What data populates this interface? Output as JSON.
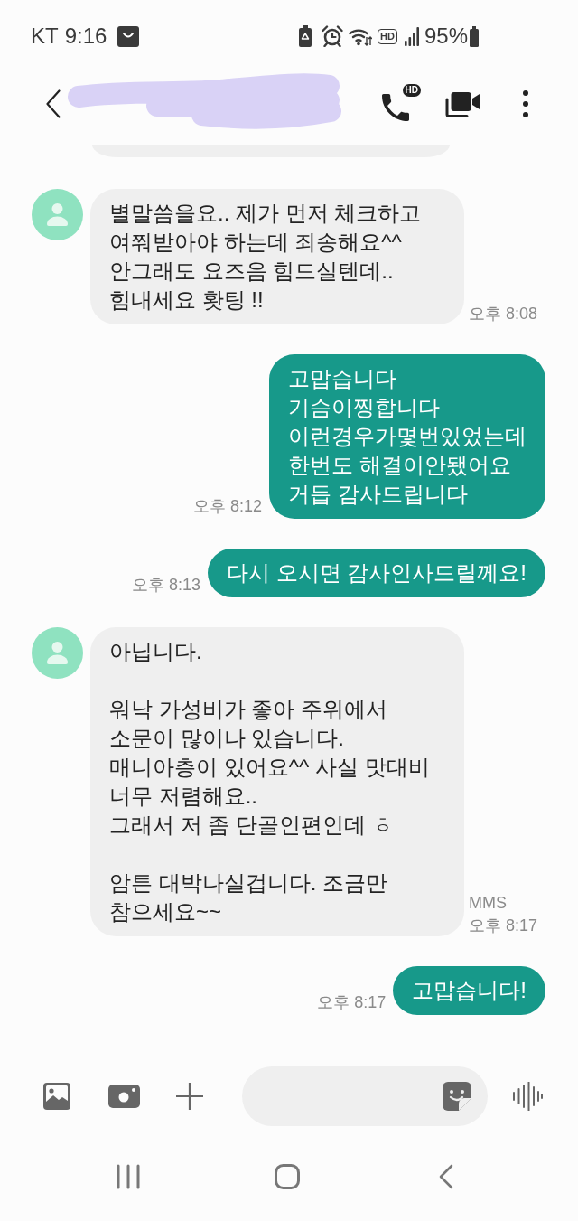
{
  "status_bar": {
    "carrier": "KT",
    "time": "9:16",
    "hd_badge": "HD",
    "battery": "95%"
  },
  "header": {
    "call_badge": "HD"
  },
  "messages": [
    {
      "kind": "received",
      "text": "별말씀을요.. 제가 먼저 체크하고\n여쭤받아야 하는데 죄송해요^^\n안그래도 요즈음 힘드실텐데..\n힘내세요 홧팅 !!",
      "time": "오후 8:08"
    },
    {
      "kind": "sent",
      "text": "고맙습니다\n기슴이찡합니다\n이런경우가몇번있었는데\n한번도 해결이안됐어요\n거듭 감사드립니다",
      "time": "오후 8:12"
    },
    {
      "kind": "sent",
      "text": "다시 오시면 감사인사드릴께요!",
      "time": "오후 8:13"
    },
    {
      "kind": "received",
      "text": "아닙니다.\n\n워낙 가성비가 좋아 주위에서\n소문이 많이나 있습니다.\n매니아층이 있어요^^ 사실 맛대비\n너무 저렴해요..\n그래서 저 좀 단골인편인데 ㅎ\n\n암튼 대박나실겁니다. 조금만\n참으세요~~",
      "type_label": "MMS",
      "time": "오후 8:17"
    },
    {
      "kind": "sent",
      "text": "고맙습니다!",
      "time": "오후 8:17"
    }
  ]
}
